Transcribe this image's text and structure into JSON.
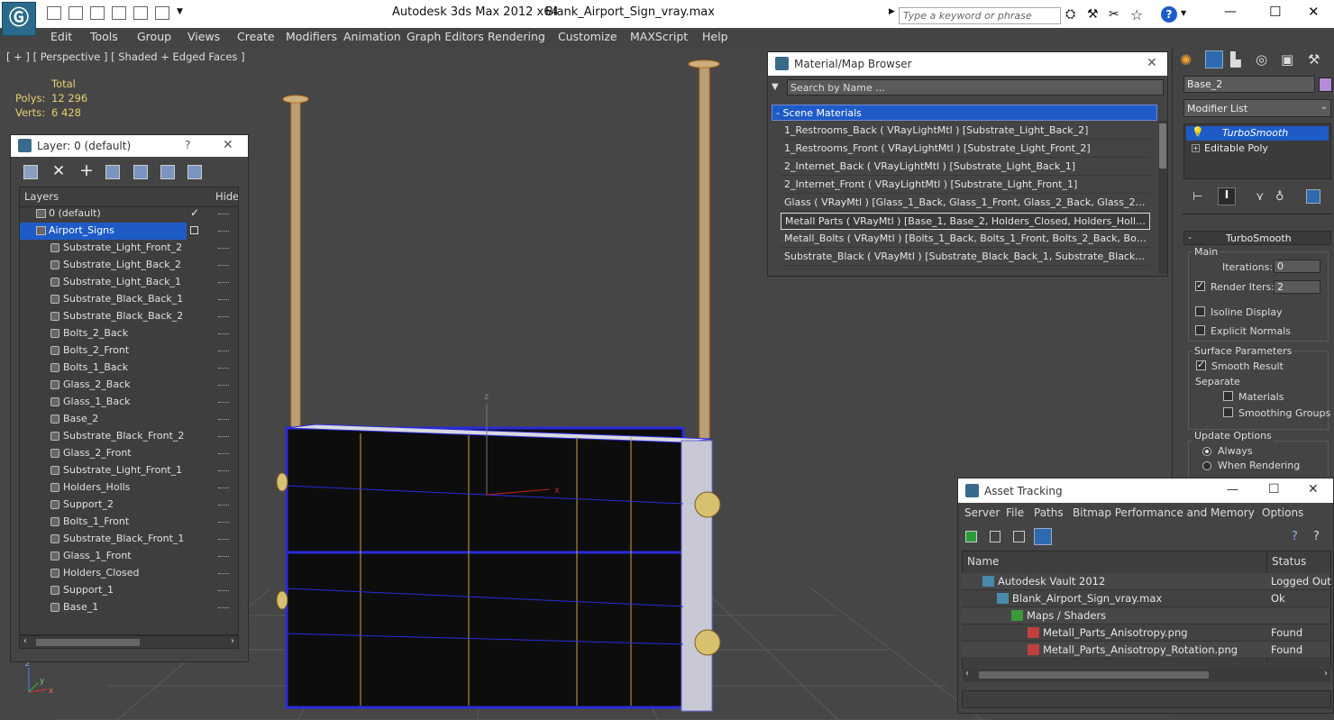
{
  "titlebar": {
    "app_title": "Autodesk 3ds Max  2012 x64",
    "file_name": "Blank_Airport_Sign_vray.max",
    "search_placeholder": "Type a keyword or phrase",
    "minimize": "—",
    "maximize": "☐",
    "close": "✕"
  },
  "menu": [
    "Edit",
    "Tools",
    "Group",
    "Views",
    "Create",
    "Modifiers",
    "Animation",
    "Graph Editors",
    "Rendering",
    "Customize",
    "MAXScript",
    "Help"
  ],
  "viewport": {
    "label": "[ + ] [ Perspective ] [ Shaded + Edged Faces ]",
    "stats_header": "Total",
    "polys_label": "Polys:",
    "polys_value": "12 296",
    "verts_label": "Verts:",
    "verts_value": "6 428",
    "axis_z": "z",
    "axis_y": "y",
    "axis_x": "x",
    "gizmo_z": "z",
    "gizmo_x": "x"
  },
  "layer_panel": {
    "title": "Layer: 0 (default)",
    "help": "?",
    "close": "✕",
    "col_layers": "Layers",
    "col_hide": "Hide",
    "default_layer": "0 (default)",
    "active_layer": "Airport_Signs",
    "objects": [
      "Substrate_Light_Front_2",
      "Substrate_Light_Back_2",
      "Substrate_Light_Back_1",
      "Substrate_Black_Back_1",
      "Substrate_Black_Back_2",
      "Bolts_2_Back",
      "Bolts_2_Front",
      "Bolts_1_Back",
      "Glass_2_Back",
      "Glass_1_Back",
      "Base_2",
      "Substrate_Black_Front_2",
      "Glass_2_Front",
      "Substrate_Light_Front_1",
      "Holders_Holls",
      "Support_2",
      "Bolts_1_Front",
      "Substrate_Black_Front_1",
      "Glass_1_Front",
      "Holders_Closed",
      "Support_1",
      "Base_1"
    ]
  },
  "material_browser": {
    "title": "Material/Map Browser",
    "close": "✕",
    "search_placeholder": "Search by Name ...",
    "section": "- Scene Materials",
    "items": [
      "1_Restrooms_Back  ( VRayLightMtl )  [Substrate_Light_Back_2]",
      "1_Restrooms_Front  ( VRayLightMtl )  [Substrate_Light_Front_2]",
      "2_Internet_Back  ( VRayLightMtl )  [Substrate_Light_Back_1]",
      "2_Internet_Front  ( VRayLightMtl )  [Substrate_Light_Front_1]",
      "Glass  ( VRayMtl )  [Glass_1_Back, Glass_1_Front, Glass_2_Back, Glass_2_Fro...",
      "Metall Parts  ( VRayMtl )  [Base_1, Base_2, Holders_Closed, Holders_Holls, Su...",
      "Metall_Bolts  ( VRayMtl )  [Bolts_1_Back, Bolts_1_Front, Bolts_2_Back, Bolts_...",
      "Substrate_Black  ( VRayMtl )  [Substrate_Black_Back_1, Substrate_Black_Back..."
    ]
  },
  "command_panel": {
    "object_name": "Base_2",
    "modifier_list": "Modifier List",
    "stack": [
      "TurboSmooth",
      "Editable Poly"
    ],
    "rollout_title": "TurboSmooth",
    "main_group": "Main",
    "iterations_label": "Iterations:",
    "iterations_value": "0",
    "render_iters_label": "Render Iters:",
    "render_iters_value": "2",
    "isoline": "Isoline Display",
    "explicit_normals": "Explicit Normals",
    "surface_group": "Surface Parameters",
    "smooth_result": "Smooth Result",
    "separate": "Separate",
    "materials": "Materials",
    "smoothing_groups": "Smoothing Groups",
    "update_group": "Update Options",
    "always": "Always",
    "when_rendering": "When Rendering"
  },
  "asset_tracking": {
    "title": "Asset Tracking",
    "minimize": "—",
    "maximize": "☐",
    "close": "✕",
    "menu": [
      "Server",
      "File",
      "Paths",
      "Bitmap Performance and Memory",
      "Options"
    ],
    "col_name": "Name",
    "col_status": "Status",
    "rows": [
      {
        "name": "Autodesk Vault 2012",
        "status": "Logged Out"
      },
      {
        "name": "Blank_Airport_Sign_vray.max",
        "status": "Ok"
      },
      {
        "name": "Maps / Shaders",
        "status": ""
      },
      {
        "name": "Metall_Parts_Anisotropy.png",
        "status": "Found"
      },
      {
        "name": "Metall_Parts_Anisotropy_Rotation.png",
        "status": "Found"
      }
    ]
  },
  "colors": {
    "selection": "#1e5bc7",
    "stats": "#e8d070",
    "wire_blue": "#2b2bd8",
    "wire_yellow": "#c9a640"
  }
}
